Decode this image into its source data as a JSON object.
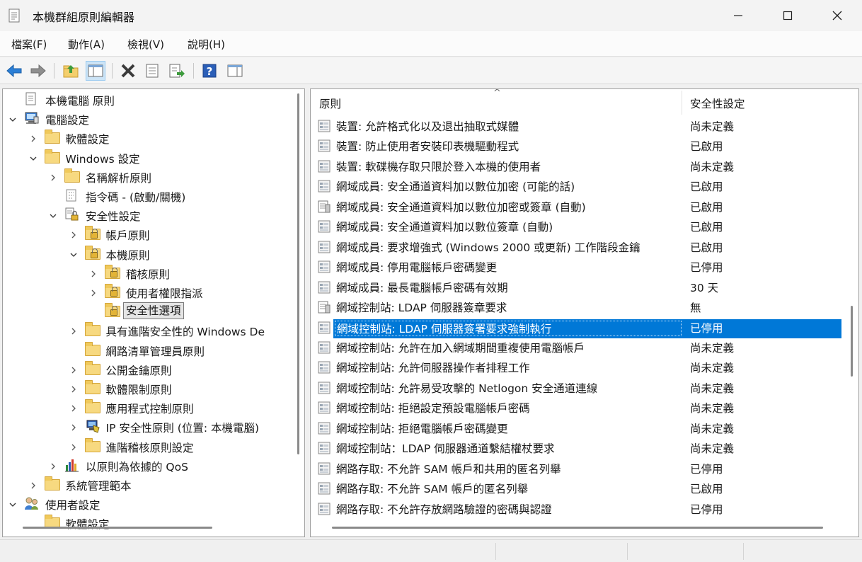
{
  "window": {
    "title": "本機群組原則編輯器"
  },
  "menu": [
    {
      "label": "檔案(F)"
    },
    {
      "label": "動作(A)"
    },
    {
      "label": "檢視(V)"
    },
    {
      "label": "說明(H)"
    }
  ],
  "toolbar": {
    "buttons": [
      "back-icon",
      "forward-icon",
      "up-folder-icon",
      "show-hide-tree-icon",
      "delete-icon",
      "properties-icon",
      "export-list-icon",
      "help-icon",
      "show-hide-action-pane-icon"
    ]
  },
  "tree": [
    {
      "label": "本機電腦 原則",
      "level": 0,
      "icon": "policy-icon",
      "expander": "none"
    },
    {
      "label": "電腦設定",
      "level": 0,
      "icon": "computer-icon",
      "expander": "expanded"
    },
    {
      "label": "軟體設定",
      "level": 1,
      "icon": "folder-icon",
      "expander": "collapsed"
    },
    {
      "label": "Windows 設定",
      "level": 1,
      "icon": "folder-icon",
      "expander": "expanded"
    },
    {
      "label": "名稱解析原則",
      "level": 2,
      "icon": "folder-icon",
      "expander": "collapsed"
    },
    {
      "label": "指令碼 - (啟動/關機)",
      "level": 2,
      "icon": "script-icon",
      "expander": "none"
    },
    {
      "label": "安全性設定",
      "level": 2,
      "icon": "security-settings-icon",
      "expander": "expanded"
    },
    {
      "label": "帳戶原則",
      "level": 3,
      "icon": "locked-folder-icon",
      "expander": "collapsed"
    },
    {
      "label": "本機原則",
      "level": 3,
      "icon": "locked-folder-icon",
      "expander": "expanded"
    },
    {
      "label": "稽核原則",
      "level": 4,
      "icon": "locked-folder-icon",
      "expander": "collapsed"
    },
    {
      "label": "使用者權限指派",
      "level": 4,
      "icon": "locked-folder-icon",
      "expander": "collapsed"
    },
    {
      "label": "安全性選項",
      "level": 4,
      "icon": "locked-folder-icon",
      "expander": "none",
      "selected": true
    },
    {
      "label": "具有進階安全性的 Windows De",
      "level": 3,
      "icon": "folder-icon",
      "expander": "collapsed"
    },
    {
      "label": "網路清單管理員原則",
      "level": 3,
      "icon": "folder-icon",
      "expander": "none"
    },
    {
      "label": "公開金鑰原則",
      "level": 3,
      "icon": "folder-icon",
      "expander": "collapsed"
    },
    {
      "label": "軟體限制原則",
      "level": 3,
      "icon": "folder-icon",
      "expander": "collapsed"
    },
    {
      "label": "應用程式控制原則",
      "level": 3,
      "icon": "folder-icon",
      "expander": "collapsed"
    },
    {
      "label": "IP 安全性原則 (位置: 本機電腦)",
      "level": 3,
      "icon": "ip-security-icon",
      "expander": "collapsed"
    },
    {
      "label": "進階稽核原則設定",
      "level": 3,
      "icon": "folder-icon",
      "expander": "collapsed"
    },
    {
      "label": "以原則為依據的 QoS",
      "level": 2,
      "icon": "qos-chart-icon",
      "expander": "collapsed"
    },
    {
      "label": "系統管理範本",
      "level": 1,
      "icon": "folder-icon",
      "expander": "collapsed"
    },
    {
      "label": "使用者設定",
      "level": 0,
      "icon": "user-icon",
      "expander": "expanded"
    },
    {
      "label": "軟體設定",
      "level": 1,
      "icon": "folder-icon",
      "expander": "none"
    }
  ],
  "list": {
    "columns": {
      "policy": "原則",
      "setting": "安全性設定"
    },
    "rows": [
      {
        "policy": "裝置: 允許格式化以及退出抽取式媒體",
        "setting": "尚未定義",
        "icon": "policy-item-icon"
      },
      {
        "policy": "裝置: 防止使用者安裝印表機驅動程式",
        "setting": "已啟用",
        "icon": "policy-item-icon"
      },
      {
        "policy": "裝置: 軟碟機存取只限於登入本機的使用者",
        "setting": "尚未定義",
        "icon": "policy-item-icon"
      },
      {
        "policy": "網域成員: 安全通道資料加以數位加密 (可能的話)",
        "setting": "已啟用",
        "icon": "policy-item-icon"
      },
      {
        "policy": "網域成員: 安全通道資料加以數位加密或簽章 (自動)",
        "setting": "已啟用",
        "icon": "policy-doc-icon"
      },
      {
        "policy": "網域成員: 安全通道資料加以數位簽章 (自動)",
        "setting": "已啟用",
        "icon": "policy-item-icon"
      },
      {
        "policy": "網域成員: 要求增強式 (Windows 2000 或更新) 工作階段金鑰",
        "setting": "已啟用",
        "icon": "policy-item-icon"
      },
      {
        "policy": "網域成員: 停用電腦帳戶密碼變更",
        "setting": "已停用",
        "icon": "policy-item-icon"
      },
      {
        "policy": "網域成員: 最長電腦帳戶密碼有效期",
        "setting": "30 天",
        "icon": "policy-item-icon"
      },
      {
        "policy": "網域控制站: LDAP 伺服器簽章要求",
        "setting": "無",
        "icon": "policy-doc-icon"
      },
      {
        "policy": "網域控制站: LDAP 伺服器簽署要求強制執行",
        "setting": "已停用",
        "icon": "policy-item-icon",
        "selected": true
      },
      {
        "policy": "網域控制站: 允許在加入網域期間重複使用電腦帳戶",
        "setting": "尚未定義",
        "icon": "policy-item-icon"
      },
      {
        "policy": "網域控制站: 允許伺服器操作者排程工作",
        "setting": "尚未定義",
        "icon": "policy-item-icon"
      },
      {
        "policy": "網域控制站: 允許易受攻擊的 Netlogon 安全通道連線",
        "setting": "尚未定義",
        "icon": "policy-item-icon"
      },
      {
        "policy": "網域控制站: 拒絕設定預設電腦帳戶密碼",
        "setting": "尚未定義",
        "icon": "policy-item-icon"
      },
      {
        "policy": "網域控制站: 拒絕電腦帳戶密碼變更",
        "setting": "尚未定義",
        "icon": "policy-item-icon"
      },
      {
        "policy": "網域控制站：LDAP 伺服器通道繫結權杖要求",
        "setting": "尚未定義",
        "icon": "policy-item-icon"
      },
      {
        "policy": "網路存取: 不允許 SAM 帳戶和共用的匿名列舉",
        "setting": "已停用",
        "icon": "policy-item-icon"
      },
      {
        "policy": "網路存取: 不允許 SAM 帳戶的匿名列舉",
        "setting": "已啟用",
        "icon": "policy-item-icon"
      },
      {
        "policy": "網路存取: 不允許存放網路驗證的密碼與認證",
        "setting": "已停用",
        "icon": "policy-item-icon"
      }
    ]
  },
  "colors": {
    "selection": "#0078d7",
    "tree_selection": "#e5e5e5"
  }
}
